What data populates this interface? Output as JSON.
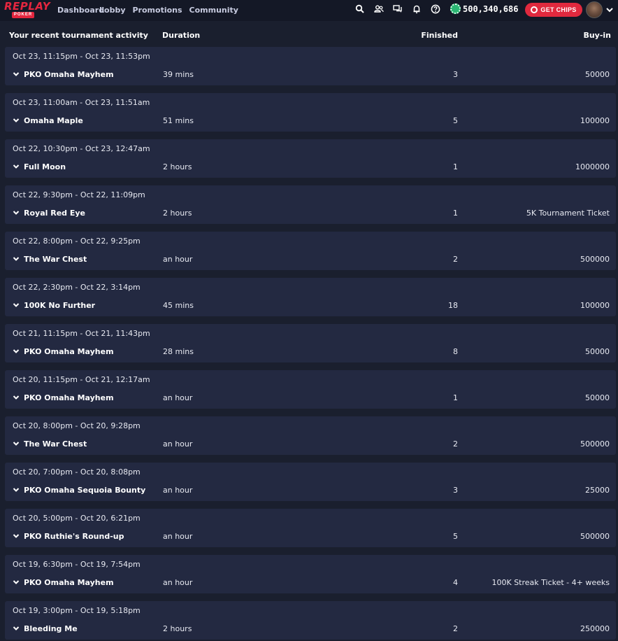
{
  "brand": {
    "logo_word": "REPLAY",
    "logo_sub": "POKER",
    "accent": "#e3263f"
  },
  "nav": {
    "items": [
      {
        "label": "Dashboard"
      },
      {
        "label": "Lobby"
      },
      {
        "label": "Promotions"
      },
      {
        "label": "Community"
      }
    ]
  },
  "header": {
    "icons": [
      "search-icon",
      "friends-icon",
      "chat-icon",
      "bell-icon",
      "help-icon"
    ],
    "chips_amount": "500,340,686",
    "get_chips_label": "GET CHIPS"
  },
  "table": {
    "columns": {
      "activity": "Your recent tournament activity",
      "duration": "Duration",
      "finished": "Finished",
      "buyin": "Buy-in"
    },
    "rows": [
      {
        "date": "Oct 23, 11:15pm - Oct 23, 11:53pm",
        "name": "PKO Omaha Mayhem",
        "duration": "39 mins",
        "finished": "3",
        "buyin": "50000"
      },
      {
        "date": "Oct 23, 11:00am - Oct 23, 11:51am",
        "name": "Omaha Maple",
        "duration": "51 mins",
        "finished": "5",
        "buyin": "100000"
      },
      {
        "date": "Oct 22, 10:30pm - Oct 23, 12:47am",
        "name": "Full Moon",
        "duration": "2 hours",
        "finished": "1",
        "buyin": "1000000"
      },
      {
        "date": "Oct 22, 9:30pm - Oct 22, 11:09pm",
        "name": "Royal Red Eye",
        "duration": "2 hours",
        "finished": "1",
        "buyin": "5K Tournament Ticket"
      },
      {
        "date": "Oct 22, 8:00pm - Oct 22, 9:25pm",
        "name": "The War Chest",
        "duration": "an hour",
        "finished": "2",
        "buyin": "500000"
      },
      {
        "date": "Oct 22, 2:30pm - Oct 22, 3:14pm",
        "name": "100K No Further",
        "duration": "45 mins",
        "finished": "18",
        "buyin": "100000"
      },
      {
        "date": "Oct 21, 11:15pm - Oct 21, 11:43pm",
        "name": "PKO Omaha Mayhem",
        "duration": "28 mins",
        "finished": "8",
        "buyin": "50000"
      },
      {
        "date": "Oct 20, 11:15pm - Oct 21, 12:17am",
        "name": "PKO Omaha Mayhem",
        "duration": "an hour",
        "finished": "1",
        "buyin": "50000"
      },
      {
        "date": "Oct 20, 8:00pm - Oct 20, 9:28pm",
        "name": "The War Chest",
        "duration": "an hour",
        "finished": "2",
        "buyin": "500000"
      },
      {
        "date": "Oct 20, 7:00pm - Oct 20, 8:08pm",
        "name": "PKO Omaha Sequoia Bounty",
        "duration": "an hour",
        "finished": "3",
        "buyin": "25000"
      },
      {
        "date": "Oct 20, 5:00pm - Oct 20, 6:21pm",
        "name": "PKO Ruthie's Round-up",
        "duration": "an hour",
        "finished": "5",
        "buyin": "500000"
      },
      {
        "date": "Oct 19, 6:30pm - Oct 19, 7:54pm",
        "name": "PKO Omaha Mayhem",
        "duration": "an hour",
        "finished": "4",
        "buyin": "100K Streak Ticket - 4+ weeks"
      },
      {
        "date": "Oct 19, 3:00pm - Oct 19, 5:18pm",
        "name": "Bleeding Me",
        "duration": "2 hours",
        "finished": "2",
        "buyin": "250000"
      }
    ]
  }
}
